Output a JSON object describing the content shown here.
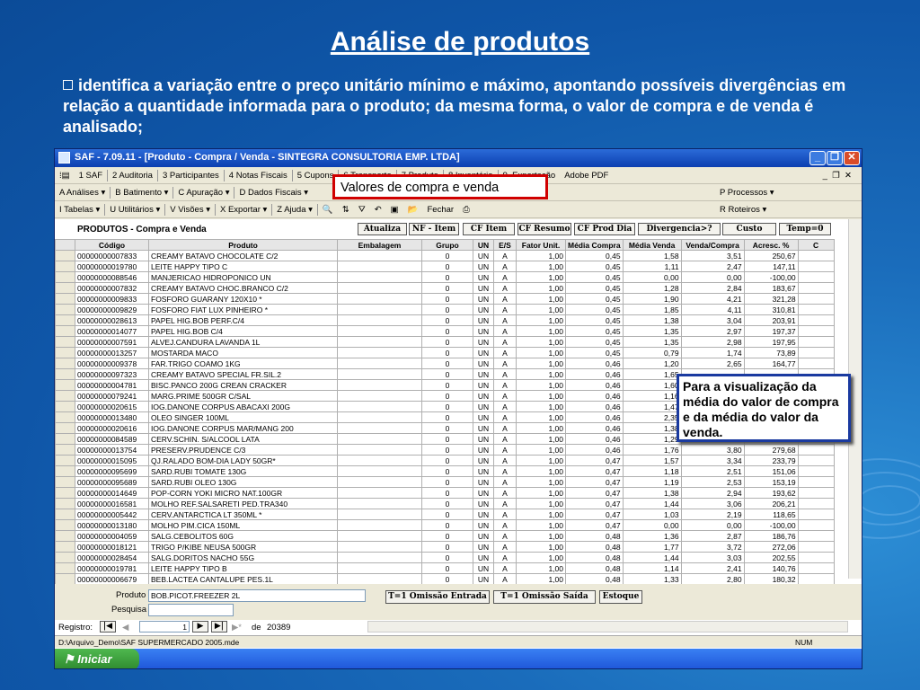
{
  "slide": {
    "title": "Análise de produtos",
    "bullet": "identifica a variação entre o preço unitário mínimo e máximo, apontando possíveis divergências em relação a quantidade informada para o produto; da mesma forma, o valor de compra e de venda é analisado;"
  },
  "window": {
    "title": "SAF - 7.09.11 - [Produto - Compra / Venda - SINTEGRA CONSULTORIA EMP. LTDA]",
    "menu": [
      "1 SAF",
      "2 Auditoria",
      "3 Participantes",
      "4 Notas Fiscais",
      "5 Cupons",
      "6 Transporte",
      "7 Produto",
      "8 Inventário",
      "9. Exportação",
      "Adobe PDF"
    ],
    "toolbar1": [
      "A Análises ▾",
      "B Batimento ▾",
      "C Apuração ▾",
      "D Dados Fiscais ▾"
    ],
    "toolbar1_right": "P Processos ▾",
    "toolbar2": [
      "I Tabelas ▾",
      "U Utilitários ▾",
      "V Visões ▾",
      "X Exportar ▾",
      "Z Ajuda ▾"
    ],
    "toolbar2_fechar": "Fechar",
    "toolbar2_right": "R Roteiros ▾"
  },
  "panel": {
    "heading": "PRODUTOS - Compra e Venda",
    "buttons": [
      "Atualiza",
      "NF - Item",
      "CF Item",
      "CF Resumo",
      "CF Prod Dia",
      "Divergencia>?",
      "Custo",
      "Temp=0"
    ],
    "columns": [
      "Código",
      "Produto",
      "Embalagem",
      "Grupo",
      "UN",
      "E/S",
      "Fator Unit.",
      "Média Compra",
      "Média Venda",
      "Venda/Compra",
      "Acresc. %",
      "C"
    ],
    "rows": [
      [
        "00000000007833",
        "CREAMY BATAVO CHOCOLATE C/2",
        "",
        "0",
        "UN",
        "A",
        "1,00",
        "0,45",
        "1,58",
        "3,51",
        "250,67"
      ],
      [
        "00000000019780",
        "LEITE HAPPY TIPO C",
        "",
        "0",
        "UN",
        "A",
        "1,00",
        "0,45",
        "1,11",
        "2,47",
        "147,11"
      ],
      [
        "00000000088546",
        "MANJERICAO HIDROPONICO UN",
        "",
        "0",
        "UN",
        "A",
        "1,00",
        "0,45",
        "0,00",
        "0,00",
        "-100,00"
      ],
      [
        "00000000007832",
        "CREAMY BATAVO CHOC.BRANCO C/2",
        "",
        "0",
        "UN",
        "A",
        "1,00",
        "0,45",
        "1,28",
        "2,84",
        "183,67"
      ],
      [
        "00000000009833",
        "FOSFORO GUARANY 120X10 *",
        "",
        "0",
        "UN",
        "A",
        "1,00",
        "0,45",
        "1,90",
        "4,21",
        "321,28"
      ],
      [
        "00000000009829",
        "FOSFORO FIAT LUX PINHEIRO *",
        "",
        "0",
        "UN",
        "A",
        "1,00",
        "0,45",
        "1,85",
        "4,11",
        "310,81"
      ],
      [
        "00000000028613",
        "PAPEL HIG.BOB PERF.C/4",
        "",
        "0",
        "UN",
        "A",
        "1,00",
        "0,45",
        "1,38",
        "3,04",
        "203,91"
      ],
      [
        "00000000014077",
        "PAPEL HIG.BOB C/4",
        "",
        "0",
        "UN",
        "A",
        "1,00",
        "0,45",
        "1,35",
        "2,97",
        "197,37"
      ],
      [
        "00000000007591",
        "ALVEJ.CANDURA LAVANDA 1L",
        "",
        "0",
        "UN",
        "A",
        "1,00",
        "0,45",
        "1,35",
        "2,98",
        "197,95"
      ],
      [
        "00000000013257",
        "MOSTARDA MACO",
        "",
        "0",
        "UN",
        "A",
        "1,00",
        "0,45",
        "0,79",
        "1,74",
        "73,89"
      ],
      [
        "00000000009378",
        "FAR.TRIGO COAMO 1KG",
        "",
        "0",
        "UN",
        "A",
        "1,00",
        "0,46",
        "1,20",
        "2,65",
        "164,77"
      ],
      [
        "00000000097323",
        "CREAMY BATAVO SPECIAL FR.SIL.2",
        "",
        "0",
        "UN",
        "A",
        "1,00",
        "0,46",
        "1,65",
        "",
        ""
      ],
      [
        "00000000004781",
        "BISC.PANCO 200G CREAN CRACKER",
        "",
        "0",
        "UN",
        "A",
        "1,00",
        "0,46",
        "1,60",
        "",
        ""
      ],
      [
        "00000000079241",
        "MARG.PRIME 500GR C/SAL",
        "",
        "0",
        "UN",
        "A",
        "1,00",
        "0,46",
        "1,16",
        "",
        ""
      ],
      [
        "00000000020615",
        "IOG.DANONE CORPUS ABACAXI 200G",
        "",
        "0",
        "UN",
        "A",
        "1,00",
        "0,46",
        "1,47",
        "",
        ""
      ],
      [
        "00000000013480",
        "OLEO SINGER 100ML",
        "",
        "0",
        "UN",
        "A",
        "1,00",
        "0,46",
        "2,35",
        "",
        ""
      ],
      [
        "00000000020616",
        "IOG.DANONE CORPUS MAR/MANG 200",
        "",
        "0",
        "UN",
        "A",
        "1,00",
        "0,46",
        "1,38",
        "",
        ""
      ],
      [
        "00000000084589",
        "CERV.SCHIN. S/ALCOOL LATA",
        "",
        "0",
        "UN",
        "A",
        "1,00",
        "0,46",
        "1,29",
        "",
        ""
      ],
      [
        "00000000013754",
        "PRESERV.PRUDENCE C/3",
        "",
        "0",
        "UN",
        "A",
        "1,00",
        "0,46",
        "1,76",
        "3,80",
        "279,68"
      ],
      [
        "00000000015095",
        "QJ.RALADO BOM-DIA LADY 50GR*",
        "",
        "0",
        "UN",
        "A",
        "1,00",
        "0,47",
        "1,57",
        "3,34",
        "233,79"
      ],
      [
        "00000000095699",
        "SARD.RUBI TOMATE 130G",
        "",
        "0",
        "UN",
        "A",
        "1,00",
        "0,47",
        "1,18",
        "2,51",
        "151,06"
      ],
      [
        "00000000095689",
        "SARD.RUBI OLEO 130G",
        "",
        "0",
        "UN",
        "A",
        "1,00",
        "0,47",
        "1,19",
        "2,53",
        "153,19"
      ],
      [
        "00000000014649",
        "POP-CORN YOKI MICRO NAT.100GR",
        "",
        "0",
        "UN",
        "A",
        "1,00",
        "0,47",
        "1,38",
        "2,94",
        "193,62"
      ],
      [
        "00000000016581",
        "MOLHO REF.SALSARETI PED.TRA340",
        "",
        "0",
        "UN",
        "A",
        "1,00",
        "0,47",
        "1,44",
        "3,06",
        "206,21"
      ],
      [
        "00000000005442",
        "CERV.ANTARCTICA LT 350ML *",
        "",
        "0",
        "UN",
        "A",
        "1,00",
        "0,47",
        "1,03",
        "2,19",
        "118,65"
      ],
      [
        "00000000013180",
        "MOLHO PIM.CICA 150ML",
        "",
        "0",
        "UN",
        "A",
        "1,00",
        "0,47",
        "0,00",
        "0,00",
        "-100,00"
      ],
      [
        "00000000004059",
        "SALG.CEBOLITOS 60G",
        "",
        "0",
        "UN",
        "A",
        "1,00",
        "0,48",
        "1,36",
        "2,87",
        "186,76"
      ],
      [
        "00000000018121",
        "TRIGO P/KIBE NEUSA 500GR",
        "",
        "0",
        "UN",
        "A",
        "1,00",
        "0,48",
        "1,77",
        "3,72",
        "272,06"
      ],
      [
        "00000000028454",
        "SALG.DORITOS NACHO 55G",
        "",
        "0",
        "UN",
        "A",
        "1,00",
        "0,48",
        "1,44",
        "3,03",
        "202,55"
      ],
      [
        "00000000019781",
        "LEITE HAPPY TIPO B",
        "",
        "0",
        "UN",
        "A",
        "1,00",
        "0,48",
        "1,14",
        "2,41",
        "140,76"
      ],
      [
        "00000000006679",
        "BEB.LACTEA CANTALUPE PES.1L",
        "",
        "0",
        "UN",
        "A",
        "1,00",
        "0,48",
        "1,33",
        "2,80",
        "180,32"
      ]
    ],
    "produto_label": "Produto",
    "produto_value": "BOB.PICOT.FREEZER 2L",
    "pesquisa_label": "Pesquisa",
    "bottom_buttons": [
      "T=1 Omissão Entrada",
      "T=1 Omissão Saída",
      "Estoque"
    ]
  },
  "nav": {
    "registro_label": "Registro:",
    "current": "1",
    "de_label": "de",
    "total": "20389"
  },
  "statusbar": {
    "path": "D:\\Arquivo_Demo\\SAF SUPERMERCADO 2005.mde",
    "num": "NUM"
  },
  "taskbar": {
    "start": "Iniciar"
  },
  "callouts": {
    "compra_venda": "Valores de compra e venda",
    "visualizacao": "Para a visualização da média do valor de compra e da média do valor da venda."
  },
  "colors": {
    "accent": "#d00000",
    "slide_bg": "#0f56a8",
    "callout_border": "#1a3aa0"
  }
}
